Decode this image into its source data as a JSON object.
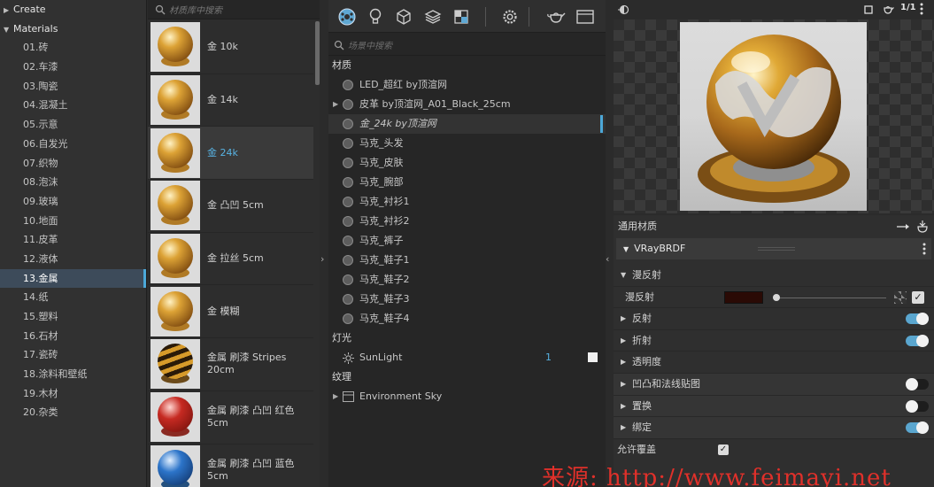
{
  "categories": {
    "create_label": "Create",
    "materials_label": "Materials",
    "items": [
      "01.砖",
      "02.车漆",
      "03.陶瓷",
      "04.混凝土",
      "05.示意",
      "06.自发光",
      "07.织物",
      "08.泡沫",
      "09.玻璃",
      "10.地面",
      "11.皮革",
      "12.液体",
      "13.金属",
      "14.纸",
      "15.塑料",
      "16.石材",
      "17.瓷砖",
      "18.涂料和壁纸",
      "19.木材",
      "20.杂类"
    ],
    "selected_index": 12
  },
  "library": {
    "search_placeholder": "材质库中搜索",
    "items": [
      {
        "line1": "金 10k",
        "line2": "",
        "ball": "gold"
      },
      {
        "line1": "金 14k",
        "line2": "",
        "ball": "gold"
      },
      {
        "line1": "金 24k",
        "line2": "",
        "ball": "gold"
      },
      {
        "line1": "金 凸凹 5cm",
        "line2": "",
        "ball": "gold"
      },
      {
        "line1": "金 拉丝 5cm",
        "line2": "",
        "ball": "gold"
      },
      {
        "line1": "金 模糊",
        "line2": "",
        "ball": "gold"
      },
      {
        "line1": "金属 刷漆 Stripes 20cm",
        "line2": "",
        "ball": "stripes"
      },
      {
        "line1": "金属 刷漆 凸凹 红色",
        "line2": "5cm",
        "ball": "red"
      },
      {
        "line1": "金属 刷漆 凸凹 蓝色",
        "line2": "5cm",
        "ball": "blue"
      }
    ],
    "selected_index": 2
  },
  "scene": {
    "search_placeholder": "场景中搜索",
    "materials_header": "材质",
    "materials": [
      {
        "name": "LED_超红 by顶渲网",
        "expandable": false
      },
      {
        "name": "皮革 by顶渲网_A01_Black_25cm",
        "expandable": true
      },
      {
        "name": "金_24k by顶渲网",
        "expandable": false
      },
      {
        "name": "马克_头发",
        "expandable": false
      },
      {
        "name": "马克_皮肤",
        "expandable": false
      },
      {
        "name": "马克_腕部",
        "expandable": false
      },
      {
        "name": "马克_衬衫1",
        "expandable": false
      },
      {
        "name": "马克_衬衫2",
        "expandable": false
      },
      {
        "name": "马克_裤子",
        "expandable": false
      },
      {
        "name": "马克_鞋子1",
        "expandable": false
      },
      {
        "name": "马克_鞋子2",
        "expandable": false
      },
      {
        "name": "马克_鞋子3",
        "expandable": false
      },
      {
        "name": "马克_鞋子4",
        "expandable": false
      }
    ],
    "selected_index": 2,
    "lights_header": "灯光",
    "light_name": "SunLight",
    "light_count": "1",
    "textures_header": "纹理",
    "texture_name": "Environment Sky"
  },
  "preview": {
    "ratio": "1/1",
    "ratio_sup": "1",
    "ratio_sub": "1"
  },
  "properties": {
    "header": "通用材质",
    "brdf_label": "VRayBRDF",
    "diffuse_section": "漫反射",
    "diffuse_label": "漫反射",
    "diffuse_color": "#2a0a05",
    "rows": [
      {
        "label": "反射",
        "toggle": "on"
      },
      {
        "label": "折射",
        "toggle": "on"
      },
      {
        "label": "透明度",
        "toggle": "none"
      },
      {
        "label": "凹凸和法线贴图",
        "toggle": "off"
      },
      {
        "label": "置换",
        "toggle": "off"
      },
      {
        "label": "绑定",
        "toggle": "on"
      }
    ],
    "allow_override_label": "允许覆盖"
  },
  "watermark": "来源: http://www.feimayi.net",
  "colors": {
    "accent": "#4ca8d8",
    "selected_text": "#58b3e3",
    "panel_bg": "#2b2b2b",
    "toggle_on": "#5aa6cf",
    "watermark": "#e0302a"
  }
}
